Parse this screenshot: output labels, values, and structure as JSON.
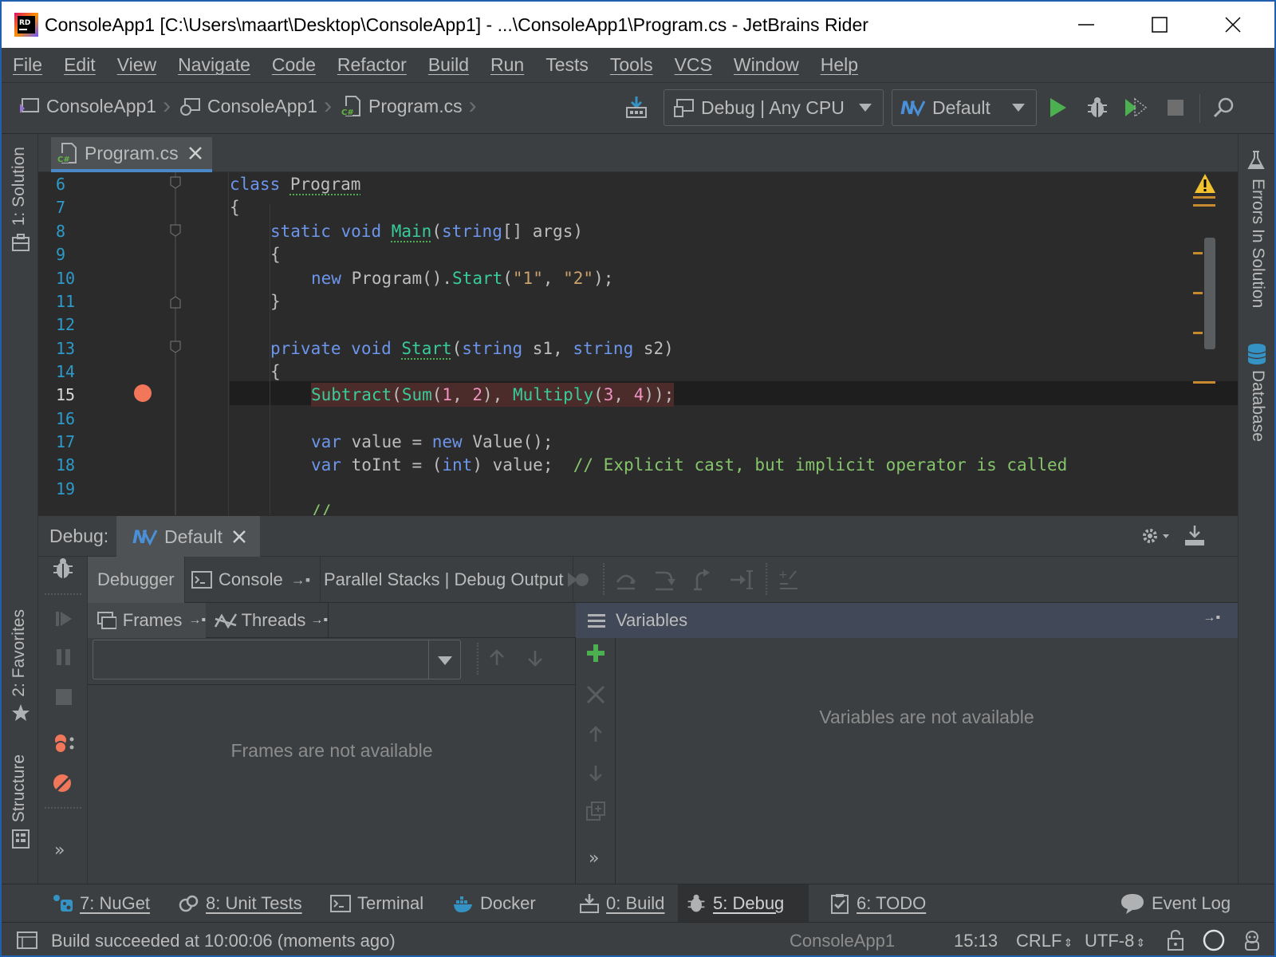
{
  "window": {
    "title": "ConsoleApp1 [C:\\Users\\maart\\Desktop\\ConsoleApp1] - ...\\ConsoleApp1\\Program.cs - JetBrains Rider",
    "app_icon_label": "RD"
  },
  "menu": [
    "File",
    "Edit",
    "View",
    "Navigate",
    "Code",
    "Refactor",
    "Build",
    "Run",
    "Tests",
    "Tools",
    "VCS",
    "Window",
    "Help"
  ],
  "breadcrumb": [
    "ConsoleApp1",
    "ConsoleApp1",
    "Program.cs"
  ],
  "toolbar": {
    "config": "Debug | Any CPU",
    "run_config": "Default"
  },
  "editor": {
    "tab": "Program.cs",
    "lines": [
      {
        "n": "6"
      },
      {
        "n": "7"
      },
      {
        "n": "8"
      },
      {
        "n": "9"
      },
      {
        "n": "10"
      },
      {
        "n": "11"
      },
      {
        "n": "12"
      },
      {
        "n": "13"
      },
      {
        "n": "14"
      },
      {
        "n": "15"
      },
      {
        "n": "16"
      },
      {
        "n": "17"
      },
      {
        "n": "18"
      },
      {
        "n": "19"
      }
    ],
    "code": {
      "l6_kw": "class",
      "l6_name": "Program",
      "l7": "{",
      "l8_static": "static",
      "l8_void": "void",
      "l8_main": "Main",
      "l8_paren": "(",
      "l8_string": "string",
      "l8_rest": "[] args)",
      "l9": "{",
      "l10_new": "new",
      "l10_prog": "Program().",
      "l10_start": "Start",
      "l10_open": "(",
      "l10_s1": "\"1\"",
      "l10_comma": ", ",
      "l10_s2": "\"2\"",
      "l10_close": ");",
      "l11": "}",
      "l13_private": "private",
      "l13_void": "void",
      "l13_start": "Start",
      "l13_open": "(",
      "l13_string1": "string",
      "l13_s1": " s1, ",
      "l13_string2": "string",
      "l13_s2": " s2)",
      "l14": "{",
      "l15_sub": "Subtract",
      "l15_open": "(",
      "l15_sum": "Sum",
      "l15_a": "(",
      "l15_1": "1",
      "l15_c1": ", ",
      "l15_2": "2",
      "l15_b": "), ",
      "l15_mul": "Multiply",
      "l15_c": "(",
      "l15_3": "3",
      "l15_c2": ", ",
      "l15_4": "4",
      "l15_end": "));",
      "l17_var": "var",
      "l17_mid": " value = ",
      "l17_new": "new",
      "l17_end": " Value();",
      "l18_var": "var",
      "l18_mid": " toInt = (",
      "l18_int": "int",
      "l18_end": ") value;  ",
      "l18_comment": "// Explicit cast, but implicit operator is called",
      "l20_partial": "//"
    }
  },
  "debug": {
    "label": "Debug:",
    "session_tab": "Default",
    "tabs": [
      "Debugger",
      "Console",
      "Parallel Stacks | Debug Output"
    ],
    "frames_tab": "Frames",
    "threads_tab": "Threads",
    "variables_title": "Variables",
    "frames_empty": "Frames are not available",
    "variables_empty": "Variables are not available"
  },
  "left_tools": {
    "solution": "1: Solution",
    "favorites": "2: Favorites",
    "structure": "Structure"
  },
  "right_tools": {
    "errors": "Errors In Solution",
    "database": "Database"
  },
  "bottom_tabs": [
    {
      "label": "7: NuGet"
    },
    {
      "label": "8: Unit Tests"
    },
    {
      "label": "Terminal"
    },
    {
      "label": "Docker"
    },
    {
      "label": "0: Build"
    },
    {
      "label": "5: Debug"
    },
    {
      "label": "6: TODO"
    },
    {
      "label": "Event Log"
    }
  ],
  "status": {
    "message": "Build succeeded at 10:00:06 (moments ago)",
    "project": "ConsoleApp1",
    "position": "15:13",
    "line_ending": "CRLF",
    "encoding": "UTF-8"
  },
  "colors": {
    "background": "#3c3f41",
    "editor_bg": "#2b2b2b",
    "keyword": "#6c95eb",
    "method": "#39cc9b",
    "string": "#c9a26d",
    "comment": "#85c46c",
    "line_number": "#2e9ac9",
    "breakpoint": "#f2765a",
    "run_green": "#4caf50"
  }
}
